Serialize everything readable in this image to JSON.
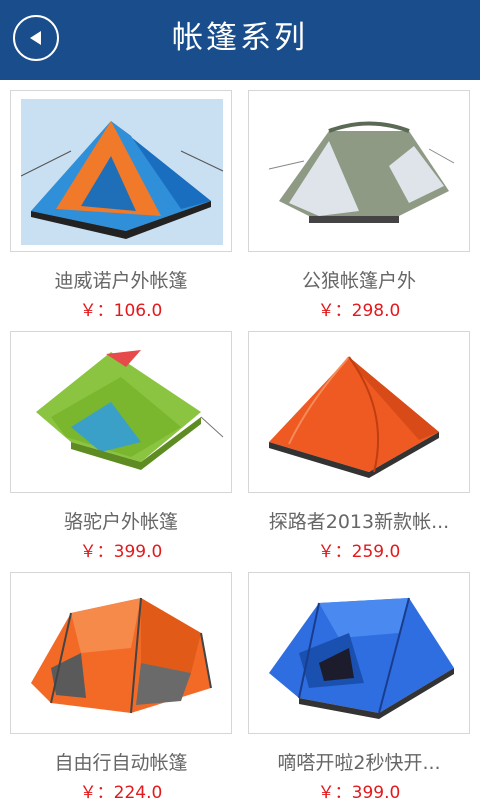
{
  "header": {
    "title": "帐篷系列",
    "back_icon": "back-arrow-icon",
    "bg_color": "#1a4d8c"
  },
  "products": [
    {
      "name": "迪威诺户外帐篷",
      "price": "￥：106.0",
      "image": "tent-image"
    },
    {
      "name": "公狼帐篷户外",
      "price": "￥：298.0",
      "image": "tent-image"
    },
    {
      "name": "骆驼户外帐篷",
      "price": "￥：399.0",
      "image": "tent-image"
    },
    {
      "name": "探路者2013新款帐...",
      "price": "￥：259.0",
      "image": "tent-image"
    },
    {
      "name": "自由行自动帐篷",
      "price": "￥：224.0",
      "image": "tent-image"
    },
    {
      "name": "嘀嗒开啦2秒快开...",
      "price": "￥：399.0",
      "image": "tent-image"
    }
  ]
}
